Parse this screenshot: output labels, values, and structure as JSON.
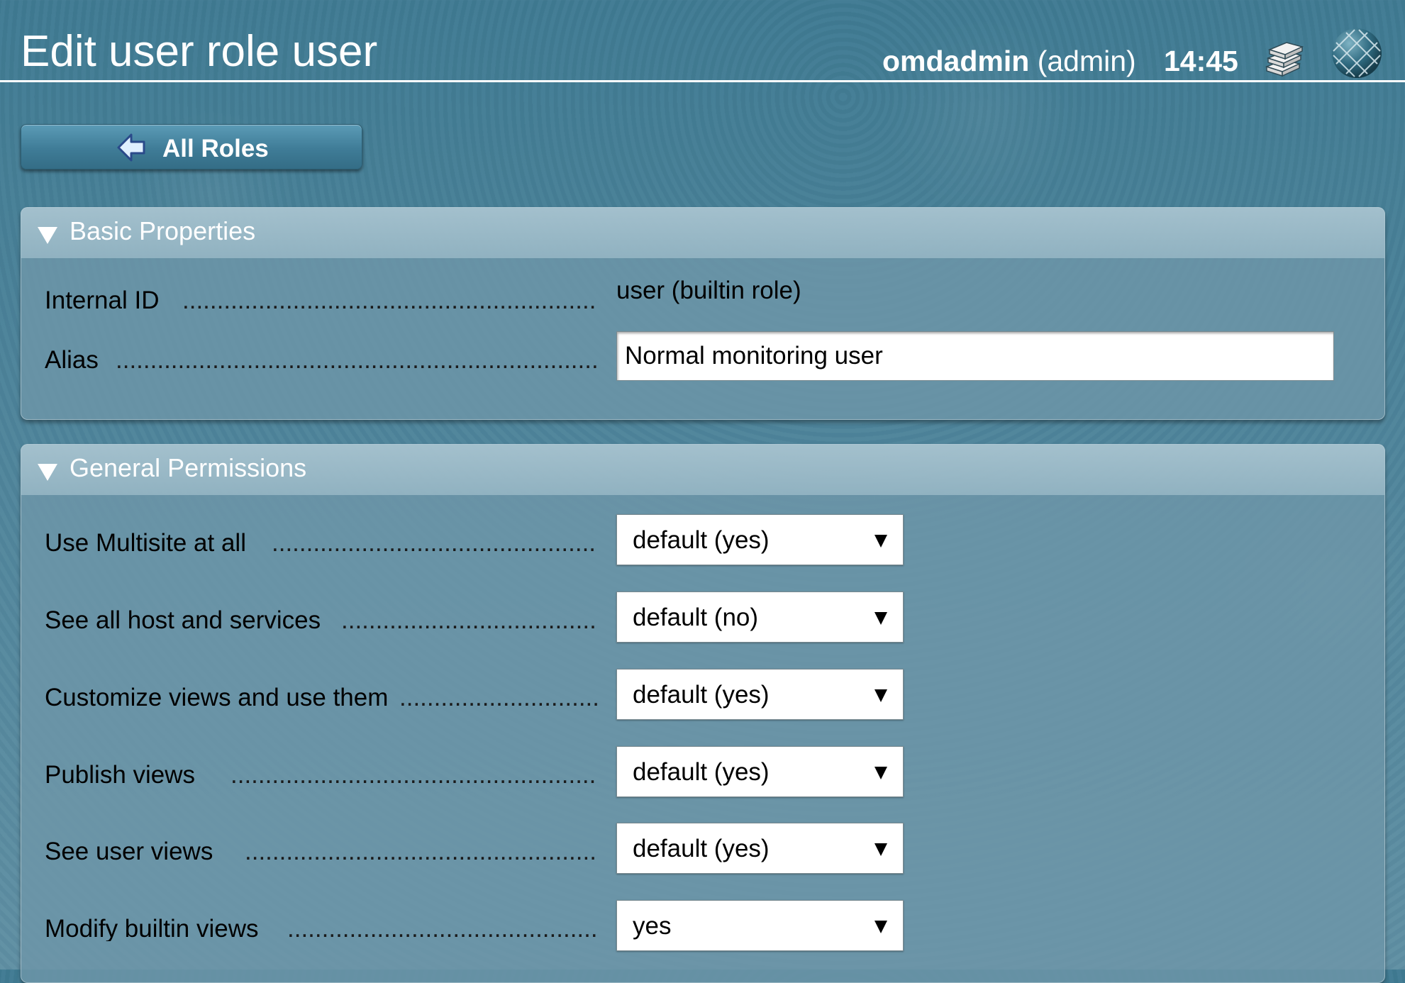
{
  "header": {
    "title": "Edit user role user",
    "username": "omdadmin",
    "role": "(admin)",
    "time": "14:45",
    "icons": [
      "books-icon",
      "globe-icon"
    ]
  },
  "back_button": {
    "label": "All Roles",
    "icon": "back-arrow-icon"
  },
  "basic_properties": {
    "title": "Basic Properties",
    "internal_id_label": "Internal ID",
    "internal_id_value": "user (builtin role)",
    "alias_label": "Alias",
    "alias_value": "Normal monitoring user"
  },
  "general_permissions": {
    "title": "General Permissions",
    "rows": [
      {
        "label": "Use Multisite at all",
        "value": "default (yes)"
      },
      {
        "label": "See all host and services",
        "value": "default (no)"
      },
      {
        "label": "Customize views and use them",
        "value": "default (yes)"
      },
      {
        "label": "Publish views",
        "value": "default (yes)"
      },
      {
        "label": "See user views",
        "value": "default (yes)"
      },
      {
        "label": "Modify builtin views",
        "value": "yes"
      }
    ]
  },
  "colors": {
    "background": "#4f8399",
    "section_header": "#a8c3cf",
    "text_light": "#ffffff"
  }
}
